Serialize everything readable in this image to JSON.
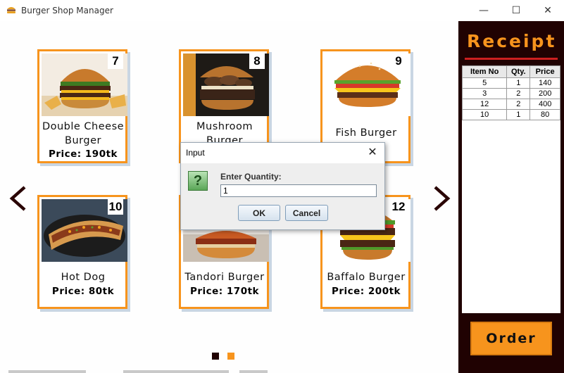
{
  "window": {
    "title": "Burger Shop Manager",
    "controls": {
      "minimize": "—",
      "maximize": "☐",
      "close": "✕"
    }
  },
  "menu": {
    "items": [
      {
        "number": "7",
        "name": "Double Cheese Burger",
        "price": "Price: 190tk",
        "image": "double-cheese-burger-photo"
      },
      {
        "number": "8",
        "name": "Mushroom Burger",
        "price": "",
        "image": "mushroom-burger-photo"
      },
      {
        "number": "9",
        "name": "Fish Burger",
        "price": "",
        "image": "fish-burger-photo"
      },
      {
        "number": "10",
        "name": "Hot Dog",
        "price": "Price: 80tk",
        "image": "hot-dog-photo"
      },
      {
        "number": "",
        "name": "Tandori Burger",
        "price": "Price: 170tk",
        "image": "tandori-burger-photo"
      },
      {
        "number": "12",
        "name": "Baffalo Burger",
        "price": "Price: 200tk",
        "image": "baffalo-burger-photo"
      }
    ],
    "prev_icon": "chevron-left-icon",
    "next_icon": "chevron-right-icon",
    "pages": {
      "count": 2,
      "active": 2,
      "active_color": "#f7941d",
      "inactive_color": "#200202"
    }
  },
  "receipt": {
    "title": "Receipt",
    "columns": [
      "Item No",
      "Qty.",
      "Price"
    ],
    "rows": [
      [
        "5",
        "1",
        "140"
      ],
      [
        "3",
        "2",
        "200"
      ],
      [
        "12",
        "2",
        "400"
      ],
      [
        "10",
        "1",
        "80"
      ]
    ],
    "order_label": "Order"
  },
  "dialog": {
    "title": "Input",
    "prompt": "Enter Quantity:",
    "value": "1",
    "icon": "question-icon",
    "icon_glyph": "?",
    "ok_label": "OK",
    "cancel_label": "Cancel",
    "close_glyph": "✕"
  },
  "colors": {
    "accent": "#f7941d",
    "panel": "#200202",
    "divider": "#cc1f1f"
  }
}
